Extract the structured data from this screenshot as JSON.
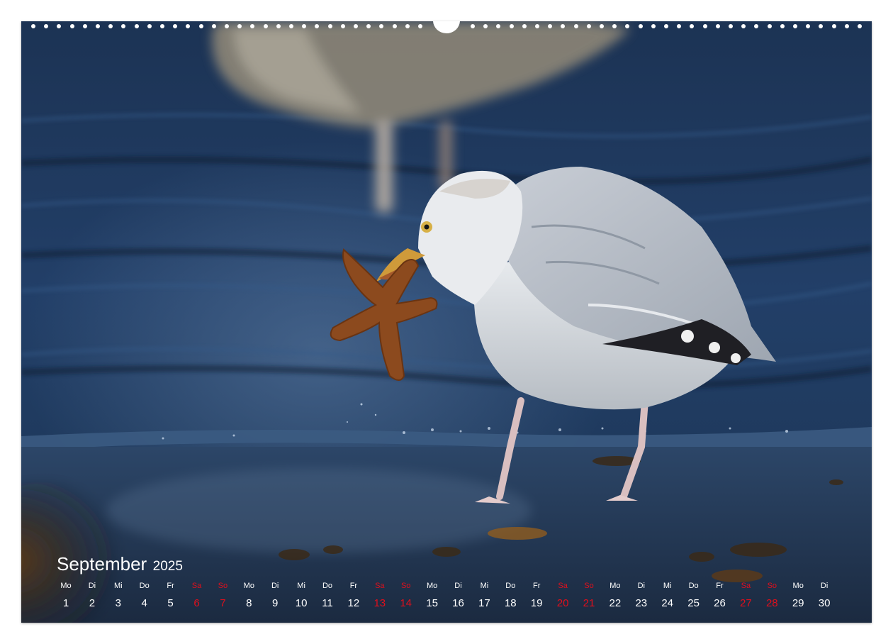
{
  "calendar": {
    "month": "September",
    "year": "2025",
    "weekend_color": "#e00f1c",
    "days": [
      {
        "wd": "Mo",
        "n": "1",
        "weekend": false
      },
      {
        "wd": "Di",
        "n": "2",
        "weekend": false
      },
      {
        "wd": "Mi",
        "n": "3",
        "weekend": false
      },
      {
        "wd": "Do",
        "n": "4",
        "weekend": false
      },
      {
        "wd": "Fr",
        "n": "5",
        "weekend": false
      },
      {
        "wd": "Sa",
        "n": "6",
        "weekend": true
      },
      {
        "wd": "So",
        "n": "7",
        "weekend": true
      },
      {
        "wd": "Mo",
        "n": "8",
        "weekend": false
      },
      {
        "wd": "Di",
        "n": "9",
        "weekend": false
      },
      {
        "wd": "Mi",
        "n": "10",
        "weekend": false
      },
      {
        "wd": "Do",
        "n": "11",
        "weekend": false
      },
      {
        "wd": "Fr",
        "n": "12",
        "weekend": false
      },
      {
        "wd": "Sa",
        "n": "13",
        "weekend": true
      },
      {
        "wd": "So",
        "n": "14",
        "weekend": true
      },
      {
        "wd": "Mo",
        "n": "15",
        "weekend": false
      },
      {
        "wd": "Di",
        "n": "16",
        "weekend": false
      },
      {
        "wd": "Mi",
        "n": "17",
        "weekend": false
      },
      {
        "wd": "Do",
        "n": "18",
        "weekend": false
      },
      {
        "wd": "Fr",
        "n": "19",
        "weekend": false
      },
      {
        "wd": "Sa",
        "n": "20",
        "weekend": true
      },
      {
        "wd": "So",
        "n": "21",
        "weekend": true
      },
      {
        "wd": "Mo",
        "n": "22",
        "weekend": false
      },
      {
        "wd": "Di",
        "n": "23",
        "weekend": false
      },
      {
        "wd": "Mi",
        "n": "24",
        "weekend": false
      },
      {
        "wd": "Do",
        "n": "25",
        "weekend": false
      },
      {
        "wd": "Fr",
        "n": "26",
        "weekend": false
      },
      {
        "wd": "Sa",
        "n": "27",
        "weekend": true
      },
      {
        "wd": "So",
        "n": "28",
        "weekend": true
      },
      {
        "wd": "Mo",
        "n": "29",
        "weekend": false
      },
      {
        "wd": "Di",
        "n": "30",
        "weekend": false
      }
    ]
  }
}
